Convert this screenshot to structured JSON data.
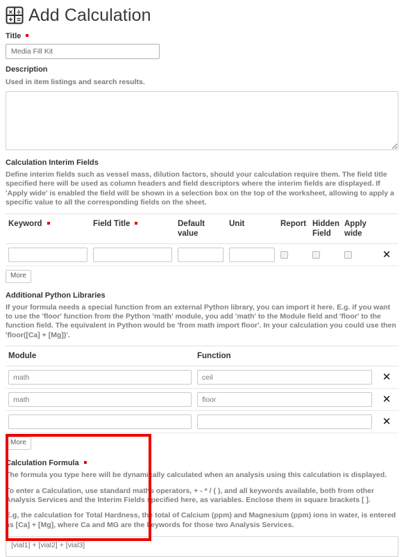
{
  "header": {
    "title": "Add Calculation",
    "icon": "calculator-icon"
  },
  "title_field": {
    "label": "Title",
    "required": true,
    "value": "Media Fill Kit",
    "placeholder": ""
  },
  "description_field": {
    "label": "Description",
    "help": "Used in item listings and search results.",
    "value": "",
    "placeholder": ""
  },
  "interim_fields": {
    "title": "Calculation Interim Fields",
    "description": "Define interim fields such as vessel mass, dilution factors, should your calculation require them. The field title specified here will be used as column headers and field descriptors where the interim fields are displayed. If 'Apply wide' is enabled the field will be shown in a selection box on the top of the worksheet, allowing to apply a specific value to all the corresponding fields on the sheet.",
    "columns": [
      {
        "label": "Keyword",
        "required": true
      },
      {
        "label": "Field Title",
        "required": true
      },
      {
        "label": "Default value",
        "required": false
      },
      {
        "label": "Unit",
        "required": false
      },
      {
        "label": "Report",
        "required": false
      },
      {
        "label": "Hidden Field",
        "required": false
      },
      {
        "label": "Apply wide",
        "required": false
      }
    ],
    "rows": [
      {
        "keyword": "",
        "field_title": "",
        "default_value": "",
        "unit": "",
        "report": false,
        "hidden_field": false,
        "apply_wide": false,
        "delete_icon": "close-x-icon"
      }
    ],
    "more_label": "More"
  },
  "python_libraries": {
    "title": "Additional Python Libraries",
    "description": "If your formula needs a special function from an external Python library, you can import it here. E.g. if you want to use the 'floor' function from the Python 'math' module, you add 'math' to the Module field and 'floor' to the function field. The equivalent in Python would be 'from math import floor'. In your calculation you could use then 'floor([Ca] + [Mg])'.",
    "columns": [
      {
        "label": "Module"
      },
      {
        "label": "Function"
      }
    ],
    "rows": [
      {
        "module": "math",
        "function": "ceil",
        "delete_icon": "close-x-icon"
      },
      {
        "module": "math",
        "function": "floor",
        "delete_icon": "close-x-icon"
      },
      {
        "module": "",
        "function": "",
        "delete_icon": "close-x-icon"
      }
    ],
    "more_label": "More"
  },
  "formula": {
    "title": "Calculation Formula",
    "required": true,
    "paragraphs": [
      "The formula you type here will be dynamically calculated when an analysis using this calculation is displayed.",
      "To enter a Calculation, use standard maths operators, + - * / ( ), and all keywords available, both from other Analysis Services and the Interim Fields specified here, as variables. Enclose them in square brackets [ ].",
      "E.g, the calculation for Total Hardness, the total of Calcium (ppm) and Magnesium (ppm) ions in water, is entered as [Ca] + [Mg], where Ca and MG are the keywords for those two Analysis Services."
    ],
    "value": "[vial1] + [vial2] + [vial3]",
    "placeholder": ""
  },
  "annotation": {
    "highlight_color": "#ee0000",
    "name": "calculation-formula-highlight"
  }
}
